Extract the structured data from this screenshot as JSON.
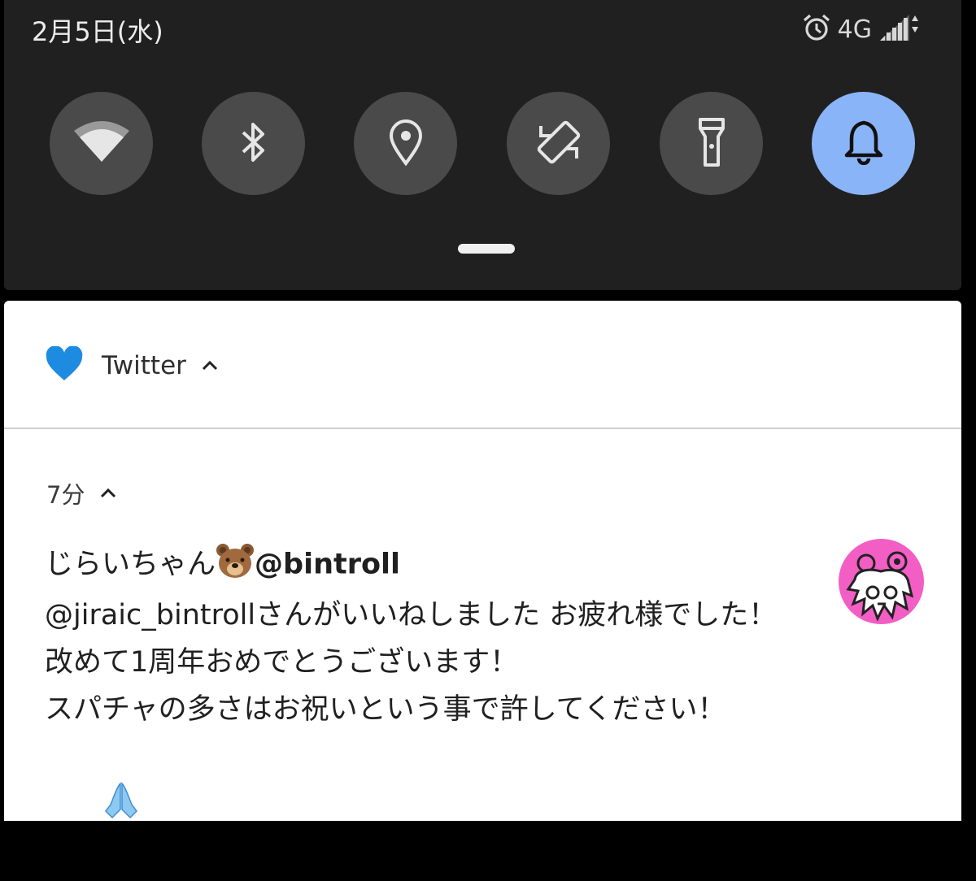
{
  "status_bar": {
    "date": "2月5日(水)",
    "network": "4G",
    "icons": [
      "alarm-icon",
      "signal-icon"
    ]
  },
  "quick_settings": {
    "tiles": [
      {
        "name": "wifi-icon",
        "active": false
      },
      {
        "name": "bluetooth-icon",
        "active": false
      },
      {
        "name": "location-icon",
        "active": false
      },
      {
        "name": "auto-rotate-icon",
        "active": false
      },
      {
        "name": "flashlight-icon",
        "active": false
      },
      {
        "name": "bell-icon",
        "active": true
      }
    ],
    "active_color": "#8ab4f8"
  },
  "notification": {
    "app_name": "Twitter",
    "app_icon": "heart-icon",
    "app_icon_color": "#1d8be0",
    "time": "7分",
    "sender_name": "じらいちゃん",
    "sender_emoji": "bear-face-emoji",
    "sender_handle": "@bintroll",
    "body": "@jiraic_bintrollさんがいいねしました お疲れ様でした！\n改めて1周年おめでとうございます！\nスパチャの多さはお祝いという事で許してください！",
    "body_emoji": "folded-hands-emoji",
    "avatar_color": "#f25ec3"
  }
}
